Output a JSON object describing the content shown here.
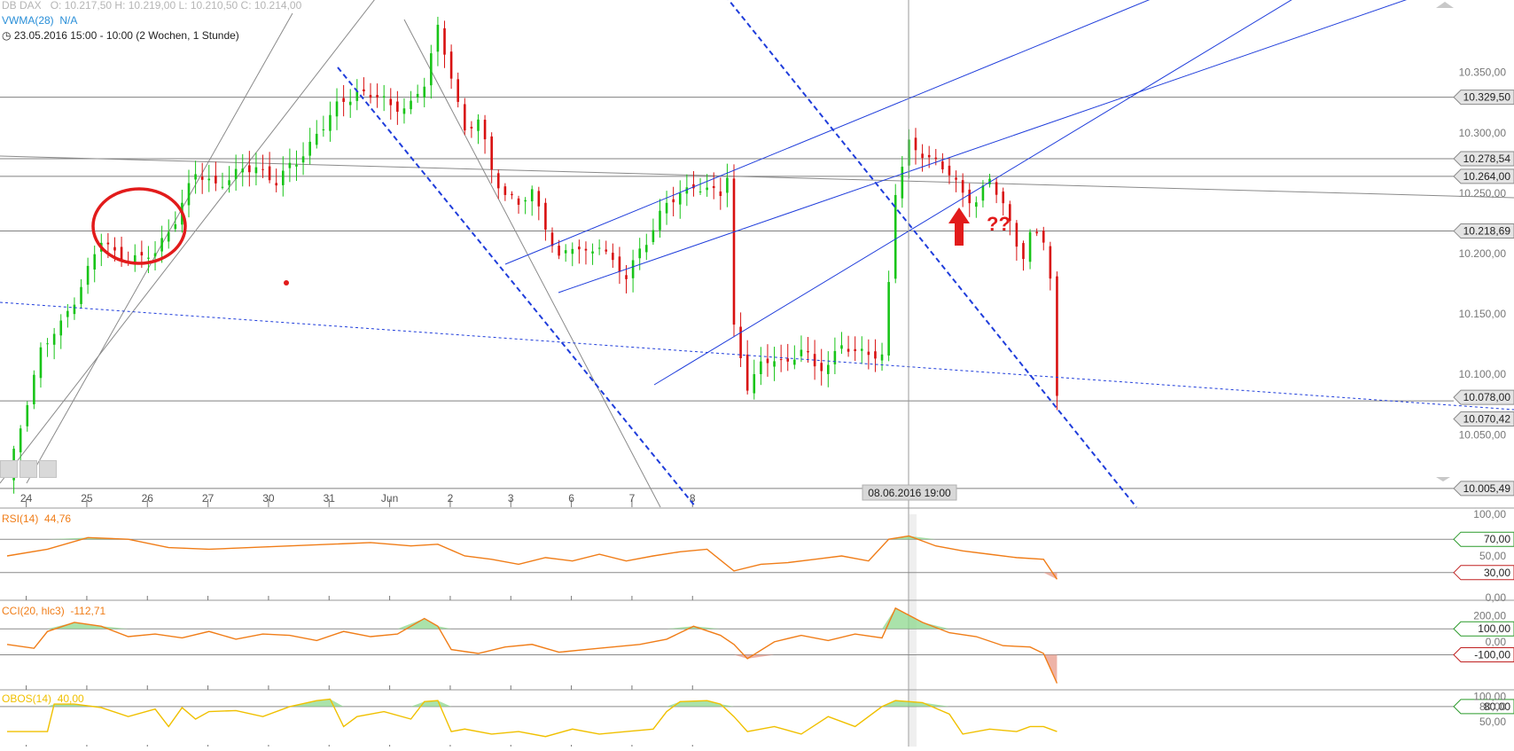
{
  "header": {
    "symbol": "DB DAX",
    "ohlc": "O: 10.217,50   H: 10.219,00   L: 10.210,50   C: 10.214,00",
    "indicator": "VWMA(28)",
    "indicator_value": "N/A",
    "range": "23.05.2016 15:00 - 10:00 (2 Wochen, 1 Stunde)"
  },
  "annotation": "??",
  "crosshair_label": "08.06.2016 19:00",
  "colors": {
    "up": "#18c418",
    "down": "#d81010",
    "trend_blue": "#1f3ddb",
    "rsi": "#f07d18",
    "obos": "#f0c000",
    "grid": "#808080"
  },
  "chart_data": [
    {
      "type": "candlestick",
      "title": "DB DAX",
      "interval": "1 Stunde",
      "ylim": [
        9990,
        10410
      ],
      "y_ticks": [
        "10.350,00",
        "10.300,00",
        "10.250,00",
        "10.200,00",
        "10.150,00",
        "10.100,00",
        "10.050,00"
      ],
      "x_tick_labels": [
        "24",
        "25",
        "26",
        "27",
        "30",
        "31",
        "Jun",
        "2",
        "3",
        "6",
        "7",
        "8"
      ],
      "horizontal_levels": [
        "10.329,50",
        "10.278,54",
        "10.264,00",
        "10.218,69",
        "10.078,00",
        "10.070,42",
        "10.005,49"
      ],
      "price_path": [
        [
          0,
          10010
        ],
        [
          3,
          10080
        ],
        [
          5,
          10120
        ],
        [
          8,
          10140
        ],
        [
          11,
          10175
        ],
        [
          14,
          10210
        ],
        [
          16,
          10200
        ],
        [
          20,
          10195
        ],
        [
          22,
          10200
        ],
        [
          25,
          10230
        ],
        [
          28,
          10265
        ],
        [
          31,
          10258
        ],
        [
          34,
          10265
        ],
        [
          37,
          10272
        ],
        [
          40,
          10260
        ],
        [
          43,
          10275
        ],
        [
          46,
          10300
        ],
        [
          49,
          10320
        ],
        [
          52,
          10335
        ],
        [
          55,
          10330
        ],
        [
          57,
          10320
        ],
        [
          60,
          10325
        ],
        [
          62,
          10340
        ],
        [
          64,
          10385
        ],
        [
          66,
          10350
        ],
        [
          68,
          10300
        ],
        [
          70,
          10310
        ],
        [
          72,
          10270
        ],
        [
          74,
          10250
        ],
        [
          76,
          10240
        ],
        [
          78,
          10250
        ],
        [
          80,
          10225
        ],
        [
          82,
          10195
        ],
        [
          84,
          10205
        ],
        [
          86,
          10200
        ],
        [
          88,
          10210
        ],
        [
          90,
          10190
        ],
        [
          92,
          10180
        ],
        [
          94,
          10205
        ],
        [
          96,
          10220
        ],
        [
          98,
          10240
        ],
        [
          100,
          10250
        ],
        [
          102,
          10258
        ],
        [
          104,
          10250
        ],
        [
          106,
          10250
        ],
        [
          107,
          10265
        ],
        [
          108,
          10140
        ],
        [
          110,
          10090
        ],
        [
          112,
          10105
        ],
        [
          114,
          10115
        ],
        [
          116,
          10110
        ],
        [
          118,
          10120
        ],
        [
          120,
          10105
        ],
        [
          122,
          10110
        ],
        [
          124,
          10125
        ],
        [
          126,
          10115
        ],
        [
          128,
          10120
        ],
        [
          130,
          10115
        ],
        [
          131,
          10175
        ],
        [
          132,
          10250
        ],
        [
          134,
          10290
        ],
        [
          136,
          10285
        ],
        [
          138,
          10275
        ],
        [
          140,
          10265
        ],
        [
          142,
          10250
        ],
        [
          144,
          10245
        ],
        [
          146,
          10260
        ],
        [
          148,
          10240
        ],
        [
          150,
          10210
        ],
        [
          151,
          10200
        ],
        [
          152,
          10215
        ],
        [
          154,
          10210
        ],
        [
          155,
          10180
        ],
        [
          156,
          10080
        ]
      ],
      "annotation": "??"
    },
    {
      "type": "line",
      "title": "RSI(14)",
      "value_label": "44,76",
      "ylim": [
        0,
        100
      ],
      "y_ticks": [
        "100,00",
        "50,00",
        "0,00"
      ],
      "levels": [
        "70,00",
        "30,00"
      ],
      "series": [
        {
          "name": "RSI(14)",
          "x": [
            0,
            6,
            12,
            18,
            24,
            30,
            36,
            42,
            48,
            54,
            60,
            64,
            68,
            72,
            76,
            80,
            84,
            88,
            92,
            96,
            100,
            104,
            108,
            112,
            116,
            120,
            124,
            128,
            131,
            134,
            138,
            142,
            146,
            150,
            154,
            156
          ],
          "values": [
            50,
            58,
            72,
            70,
            60,
            58,
            60,
            62,
            64,
            66,
            62,
            64,
            50,
            46,
            40,
            48,
            44,
            52,
            44,
            50,
            55,
            58,
            32,
            40,
            42,
            46,
            50,
            44,
            70,
            74,
            62,
            56,
            52,
            48,
            46,
            22
          ]
        }
      ]
    },
    {
      "type": "line",
      "title": "CCI(20, hlc3)",
      "value_label": "-112,71",
      "y_ticks": [
        "200,00",
        "0,00"
      ],
      "levels": [
        "100,00",
        "-100,00"
      ],
      "series": [
        {
          "name": "CCI(20, hlc3)",
          "x": [
            0,
            4,
            6,
            10,
            14,
            18,
            22,
            26,
            30,
            34,
            38,
            42,
            46,
            50,
            54,
            58,
            62,
            64,
            66,
            70,
            74,
            78,
            82,
            86,
            90,
            94,
            98,
            102,
            106,
            108,
            110,
            114,
            118,
            122,
            126,
            130,
            132,
            136,
            140,
            144,
            148,
            152,
            154,
            156
          ],
          "values": [
            -20,
            -50,
            80,
            150,
            120,
            40,
            60,
            30,
            80,
            20,
            60,
            50,
            10,
            80,
            40,
            60,
            180,
            120,
            -60,
            -90,
            -40,
            -20,
            -80,
            -60,
            -40,
            -20,
            20,
            120,
            50,
            -20,
            -130,
            0,
            50,
            10,
            60,
            30,
            260,
            150,
            70,
            40,
            -30,
            -40,
            -90,
            -320
          ]
        }
      ]
    },
    {
      "type": "line",
      "title": "OBOS(14)",
      "value_label": "40,00",
      "y_ticks": [
        "100,00",
        "80,00",
        "50,00"
      ],
      "levels": [
        "80,00"
      ],
      "series": [
        {
          "name": "OBOS(14)",
          "x": [
            0,
            6,
            7,
            10,
            14,
            18,
            22,
            24,
            26,
            28,
            30,
            34,
            38,
            42,
            46,
            48,
            50,
            52,
            56,
            60,
            62,
            64,
            66,
            68,
            72,
            76,
            80,
            84,
            88,
            92,
            96,
            98,
            100,
            104,
            106,
            108,
            110,
            114,
            118,
            122,
            126,
            130,
            132,
            136,
            140,
            142,
            146,
            150,
            152,
            154,
            156
          ],
          "values": [
            30,
            30,
            85,
            85,
            78,
            60,
            75,
            40,
            78,
            55,
            70,
            72,
            60,
            80,
            92,
            95,
            40,
            60,
            70,
            55,
            90,
            92,
            30,
            35,
            25,
            30,
            20,
            35,
            25,
            30,
            35,
            70,
            90,
            92,
            85,
            60,
            30,
            40,
            25,
            60,
            40,
            80,
            92,
            88,
            65,
            25,
            35,
            30,
            40,
            40,
            30
          ]
        }
      ]
    }
  ]
}
